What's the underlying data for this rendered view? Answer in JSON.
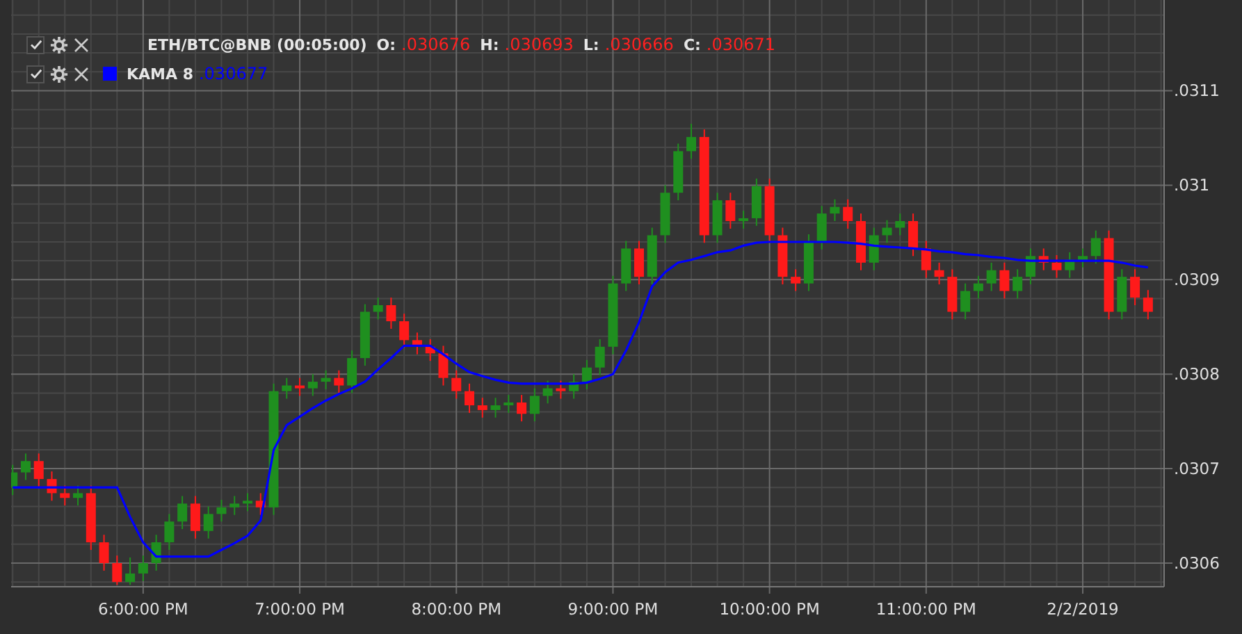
{
  "legend": [
    {
      "kind": "ohlc",
      "checked": true,
      "name": "ETH/BTC@BNB (00:05:00)",
      "fields": [
        {
          "label": "O:",
          "value": ".030676"
        },
        {
          "label": "H:",
          "value": ".030693"
        },
        {
          "label": "L:",
          "value": ".030666"
        },
        {
          "label": "C:",
          "value": ".030671"
        }
      ]
    },
    {
      "kind": "indicator",
      "checked": true,
      "value": ".030677"
    }
  ],
  "chart": {
    "chart_data": {
      "type": "candlestick",
      "grid": true,
      "ylim": [
        0.030575,
        0.031196
      ],
      "yticks": [
        {
          "value": 0.0306,
          "label": ".0306"
        },
        {
          "value": 0.0307,
          "label": ".0307"
        },
        {
          "value": 0.0308,
          "label": ".0308"
        },
        {
          "value": 0.0309,
          "label": ".0309"
        },
        {
          "value": 0.031,
          "label": ".031"
        },
        {
          "value": 0.0311,
          "label": ".0311"
        }
      ],
      "categories": [
        null,
        null,
        null,
        null,
        null,
        null,
        null,
        null,
        null,
        null,
        "6:00:00 PM",
        null,
        null,
        null,
        null,
        null,
        null,
        null,
        null,
        null,
        null,
        null,
        "7:00:00 PM",
        null,
        null,
        null,
        null,
        null,
        null,
        null,
        null,
        null,
        null,
        null,
        "8:00:00 PM",
        null,
        null,
        null,
        null,
        null,
        null,
        null,
        null,
        null,
        null,
        null,
        "9:00:00 PM",
        null,
        null,
        null,
        null,
        null,
        null,
        null,
        null,
        null,
        null,
        null,
        "10:00:00 PM",
        null,
        null,
        null,
        null,
        null,
        null,
        null,
        null,
        null,
        null,
        null,
        "11:00:00 PM",
        null,
        null,
        null,
        null,
        null,
        null,
        null,
        null,
        null,
        null,
        null,
        "2/2/2019",
        null,
        null,
        null,
        null,
        null
      ],
      "ohlc": [
        [
          0.03068,
          0.030704,
          0.030672,
          0.030696
        ],
        [
          0.030696,
          0.030716,
          0.030688,
          0.030708
        ],
        [
          0.030708,
          0.030716,
          0.030681,
          0.030689
        ],
        [
          0.030689,
          0.030697,
          0.030666,
          0.030674
        ],
        [
          0.030674,
          0.030682,
          0.030661,
          0.030669
        ],
        [
          0.030669,
          0.030682,
          0.030661,
          0.030674
        ],
        [
          0.030674,
          0.030682,
          0.030614,
          0.030622
        ],
        [
          0.030622,
          0.03063,
          0.030592,
          0.0306
        ],
        [
          0.0306,
          0.030608,
          0.030577,
          0.03058
        ],
        [
          0.03058,
          0.030606,
          0.030577,
          0.030589
        ],
        [
          0.030589,
          0.030608,
          0.030581,
          0.0306
        ],
        [
          0.0306,
          0.03063,
          0.030592,
          0.030622
        ],
        [
          0.030622,
          0.030652,
          0.030614,
          0.030644
        ],
        [
          0.030644,
          0.030671,
          0.030636,
          0.030663
        ],
        [
          0.030663,
          0.030671,
          0.030626,
          0.030634
        ],
        [
          0.030634,
          0.03066,
          0.030626,
          0.030652
        ],
        [
          0.030652,
          0.030667,
          0.030644,
          0.030659
        ],
        [
          0.030659,
          0.030671,
          0.030651,
          0.030663
        ],
        [
          0.030663,
          0.030674,
          0.030655,
          0.030666
        ],
        [
          0.030666,
          0.030674,
          0.030651,
          0.030659
        ],
        [
          0.030659,
          0.03079,
          0.030651,
          0.030782
        ],
        [
          0.030782,
          0.030796,
          0.030774,
          0.030788
        ],
        [
          0.030788,
          0.030796,
          0.030777,
          0.030785
        ],
        [
          0.030785,
          0.0308,
          0.030777,
          0.030792
        ],
        [
          0.030792,
          0.030804,
          0.030784,
          0.030796
        ],
        [
          0.030796,
          0.030804,
          0.03078,
          0.030788
        ],
        [
          0.030788,
          0.030825,
          0.03078,
          0.030817
        ],
        [
          0.030817,
          0.030874,
          0.030809,
          0.030866
        ],
        [
          0.030866,
          0.030881,
          0.030858,
          0.030873
        ],
        [
          0.030873,
          0.030881,
          0.030848,
          0.030856
        ],
        [
          0.030856,
          0.030864,
          0.030828,
          0.030836
        ],
        [
          0.030836,
          0.030844,
          0.030821,
          0.030829
        ],
        [
          0.030829,
          0.030837,
          0.030814,
          0.030822
        ],
        [
          0.030822,
          0.03083,
          0.030788,
          0.030796
        ],
        [
          0.030796,
          0.030804,
          0.030774,
          0.030782
        ],
        [
          0.030782,
          0.03079,
          0.030759,
          0.030767
        ],
        [
          0.030767,
          0.030775,
          0.030754,
          0.030762
        ],
        [
          0.030762,
          0.030775,
          0.030754,
          0.030767
        ],
        [
          0.030767,
          0.030778,
          0.030759,
          0.03077
        ],
        [
          0.03077,
          0.030778,
          0.03075,
          0.030758
        ],
        [
          0.030758,
          0.030785,
          0.03075,
          0.030777
        ],
        [
          0.030777,
          0.030793,
          0.030769,
          0.030785
        ],
        [
          0.030785,
          0.030793,
          0.030774,
          0.030782
        ],
        [
          0.030782,
          0.0308,
          0.030774,
          0.030792
        ],
        [
          0.030792,
          0.030815,
          0.030784,
          0.030807
        ],
        [
          0.030807,
          0.030837,
          0.030799,
          0.030829
        ],
        [
          0.030829,
          0.030904,
          0.030821,
          0.030896
        ],
        [
          0.030896,
          0.030941,
          0.030888,
          0.030933
        ],
        [
          0.030933,
          0.030941,
          0.030895,
          0.030903
        ],
        [
          0.030903,
          0.030955,
          0.030895,
          0.030947
        ],
        [
          0.030947,
          0.031,
          0.030939,
          0.030992
        ],
        [
          0.030992,
          0.031044,
          0.030984,
          0.031036
        ],
        [
          0.031036,
          0.031065,
          0.031028,
          0.031051
        ],
        [
          0.031051,
          0.031059,
          0.030939,
          0.030947
        ],
        [
          0.030947,
          0.030992,
          0.030939,
          0.030984
        ],
        [
          0.030984,
          0.030992,
          0.030954,
          0.030962
        ],
        [
          0.030962,
          0.030973,
          0.030954,
          0.030965
        ],
        [
          0.030965,
          0.031007,
          0.030957,
          0.030999
        ],
        [
          0.030999,
          0.031007,
          0.030939,
          0.030947
        ],
        [
          0.030947,
          0.030955,
          0.030895,
          0.030903
        ],
        [
          0.030903,
          0.030911,
          0.030888,
          0.030896
        ],
        [
          0.030896,
          0.030948,
          0.030888,
          0.03094
        ],
        [
          0.03094,
          0.030978,
          0.030932,
          0.03097
        ],
        [
          0.03097,
          0.030985,
          0.030962,
          0.030977
        ],
        [
          0.030977,
          0.030985,
          0.030954,
          0.030962
        ],
        [
          0.030962,
          0.03097,
          0.03091,
          0.030918
        ],
        [
          0.030918,
          0.030955,
          0.03091,
          0.030947
        ],
        [
          0.030947,
          0.030963,
          0.030939,
          0.030955
        ],
        [
          0.030955,
          0.03097,
          0.030947,
          0.030962
        ],
        [
          0.030962,
          0.03097,
          0.030925,
          0.030933
        ],
        [
          0.030933,
          0.030941,
          0.030902,
          0.03091
        ],
        [
          0.03091,
          0.030918,
          0.030895,
          0.030903
        ],
        [
          0.030903,
          0.030911,
          0.030858,
          0.030866
        ],
        [
          0.030866,
          0.030896,
          0.030858,
          0.030888
        ],
        [
          0.030888,
          0.030904,
          0.03088,
          0.030896
        ],
        [
          0.030896,
          0.030918,
          0.030888,
          0.03091
        ],
        [
          0.03091,
          0.030918,
          0.03088,
          0.030888
        ],
        [
          0.030888,
          0.030911,
          0.03088,
          0.030903
        ],
        [
          0.030903,
          0.030933,
          0.030895,
          0.030925
        ],
        [
          0.030925,
          0.030933,
          0.03091,
          0.030918
        ],
        [
          0.030918,
          0.030926,
          0.030902,
          0.03091
        ],
        [
          0.03091,
          0.030929,
          0.030902,
          0.030921
        ],
        [
          0.030921,
          0.030933,
          0.030913,
          0.030925
        ],
        [
          0.030925,
          0.030952,
          0.030917,
          0.030944
        ],
        [
          0.030944,
          0.030952,
          0.030858,
          0.030866
        ],
        [
          0.030866,
          0.030911,
          0.030858,
          0.030903
        ],
        [
          0.030903,
          0.030911,
          0.030873,
          0.030881
        ],
        [
          0.030881,
          0.030889,
          0.030858,
          0.030866
        ]
      ],
      "series": [
        {
          "name": "KAMA 8",
          "type": "line",
          "color": "#0000ff",
          "values": [
            0.03068,
            0.03068,
            0.03068,
            0.03068,
            0.03068,
            0.03068,
            0.03068,
            0.03068,
            0.03068,
            0.030649,
            0.030622,
            0.030607,
            0.030607,
            0.030607,
            0.030607,
            0.030607,
            0.030614,
            0.030621,
            0.030629,
            0.030645,
            0.03072,
            0.030746,
            0.030755,
            0.030764,
            0.030772,
            0.030779,
            0.030785,
            0.030792,
            0.030805,
            0.030817,
            0.03083,
            0.03083,
            0.03083,
            0.030821,
            0.030811,
            0.030802,
            0.030798,
            0.030794,
            0.030791,
            0.03079,
            0.03079,
            0.03079,
            0.03079,
            0.03079,
            0.030791,
            0.030795,
            0.0308,
            0.030825,
            0.030855,
            0.030893,
            0.030908,
            0.030918,
            0.030921,
            0.030925,
            0.030929,
            0.030931,
            0.030936,
            0.030939,
            0.03094,
            0.03094,
            0.03094,
            0.03094,
            0.03094,
            0.03094,
            0.030939,
            0.030938,
            0.030936,
            0.030935,
            0.030934,
            0.030933,
            0.030932,
            0.03093,
            0.030929,
            0.030927,
            0.030926,
            0.030924,
            0.030923,
            0.030921,
            0.03092,
            0.03092,
            0.03092,
            0.03092,
            0.03092,
            0.03092,
            0.03092,
            0.030918,
            0.030915,
            0.030913
          ]
        }
      ]
    }
  }
}
